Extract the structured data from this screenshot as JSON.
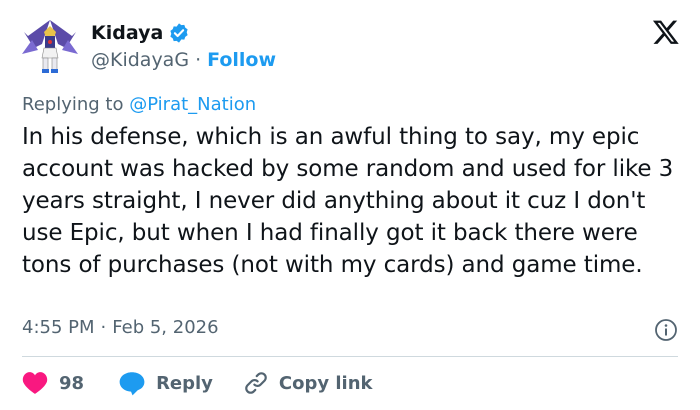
{
  "author": {
    "display_name": "Kidaya",
    "handle": "@KidayaG",
    "separator": "·",
    "follow_label": "Follow"
  },
  "reply_context": {
    "prefix": "Replying to ",
    "mention": "@Pirat_Nation"
  },
  "tweet": {
    "text": "In his defense, which is an awful thing to say, my epic account was hacked by some random and used for like 3 years straight, I never did anything about it cuz I don't use Epic, but when I had finally got it back there were tons of purchases (not with my cards) and game time."
  },
  "meta": {
    "time": "4:55 PM",
    "separator": "·",
    "date": "Feb 5, 2026"
  },
  "actions": {
    "like_count": "98",
    "reply_label": "Reply",
    "copy_label": "Copy link"
  },
  "colors": {
    "accent": "#1d9bf0",
    "like": "#f91880",
    "muted": "#536471"
  },
  "icons": [
    "avatar-robot",
    "verified-badge-icon",
    "x-logo-icon",
    "info-icon",
    "heart-icon",
    "reply-bubble-icon",
    "link-icon"
  ]
}
